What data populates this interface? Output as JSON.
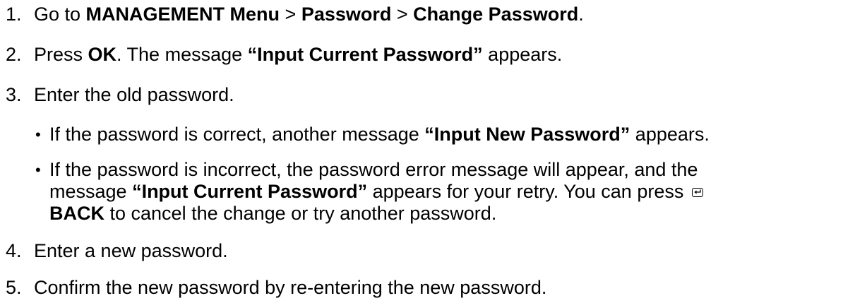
{
  "steps": [
    {
      "number": "1.",
      "parts": [
        "Go to ",
        "MANAGEMENT Menu",
        " > ",
        "Password",
        " > ",
        "Change Password",
        "."
      ]
    },
    {
      "number": "2.",
      "parts": [
        "Press ",
        "OK",
        ". The message ",
        "“Input Current Password”",
        " appears."
      ]
    },
    {
      "number": "3.",
      "text": "Enter the old password.",
      "bullets": [
        {
          "symbol": "•",
          "parts": [
            "If the password is correct, another message ",
            "“Input New Password”",
            " appears."
          ]
        },
        {
          "symbol": "•",
          "line1": "If the password is incorrect, the password error message will appear, and the",
          "line2_parts": [
            "message ",
            "“Input Current Password”",
            " appears for your retry. You can press"
          ],
          "icon": "back-return-icon",
          "line3_parts": [
            "BACK",
            " to cancel the change or try another password."
          ]
        }
      ]
    },
    {
      "number": "4.",
      "text": "Enter a new password."
    },
    {
      "number": "5.",
      "text": "Confirm the new password by re-entering the new password."
    }
  ]
}
